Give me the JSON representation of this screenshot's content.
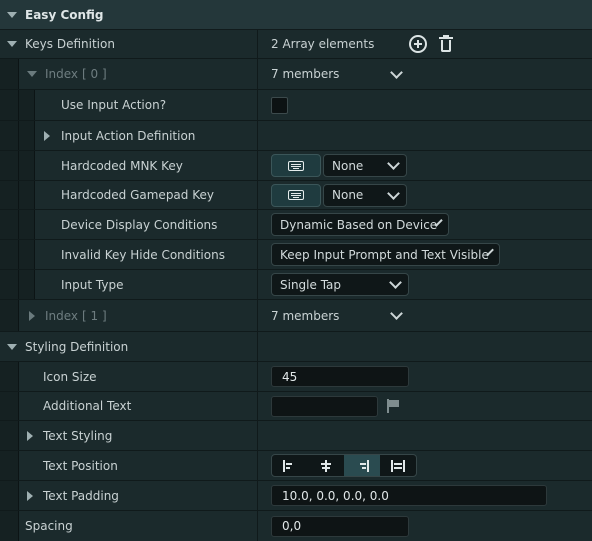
{
  "section": {
    "title": "Easy Config"
  },
  "keys_definition": {
    "label": "Keys Definition",
    "value": "2 Array elements",
    "add_tooltip_icon": "circle-plus-icon",
    "delete_icon": "trash-icon"
  },
  "index0": {
    "label": "Index",
    "index_text": "[ 0 ]",
    "value": "7 members",
    "use_input_action": {
      "label": "Use Input Action?",
      "checked": false
    },
    "input_action_definition": {
      "label": "Input Action Definition"
    },
    "hardcoded_mnk": {
      "label": "Hardcoded MNK Key",
      "value": "None"
    },
    "hardcoded_gamepad": {
      "label": "Hardcoded Gamepad Key",
      "value": "None"
    },
    "device_display": {
      "label": "Device Display Conditions",
      "value": "Dynamic Based on Device"
    },
    "invalid_key_hide": {
      "label": "Invalid Key Hide Conditions",
      "value": "Keep Input Prompt and Text Visible"
    },
    "input_type": {
      "label": "Input Type",
      "value": "Single Tap"
    }
  },
  "index1": {
    "label": "Index",
    "index_text": "[ 1 ]",
    "value": "7 members"
  },
  "styling": {
    "label": "Styling Definition",
    "icon_size": {
      "label": "Icon Size",
      "value": "45"
    },
    "additional_text": {
      "label": "Additional Text",
      "value": ""
    },
    "text_styling": {
      "label": "Text Styling"
    },
    "text_position": {
      "label": "Text Position",
      "options": [
        "left",
        "center",
        "right",
        "fill"
      ],
      "selected": "right"
    },
    "text_padding": {
      "label": "Text Padding",
      "value": "10.0, 0.0, 0.0, 0.0"
    }
  },
  "spacing": {
    "label": "Spacing",
    "value": "0,0"
  },
  "colors": {
    "background": "#1a2628",
    "header": "#24373a",
    "active_toggle": "#2a4b50"
  }
}
